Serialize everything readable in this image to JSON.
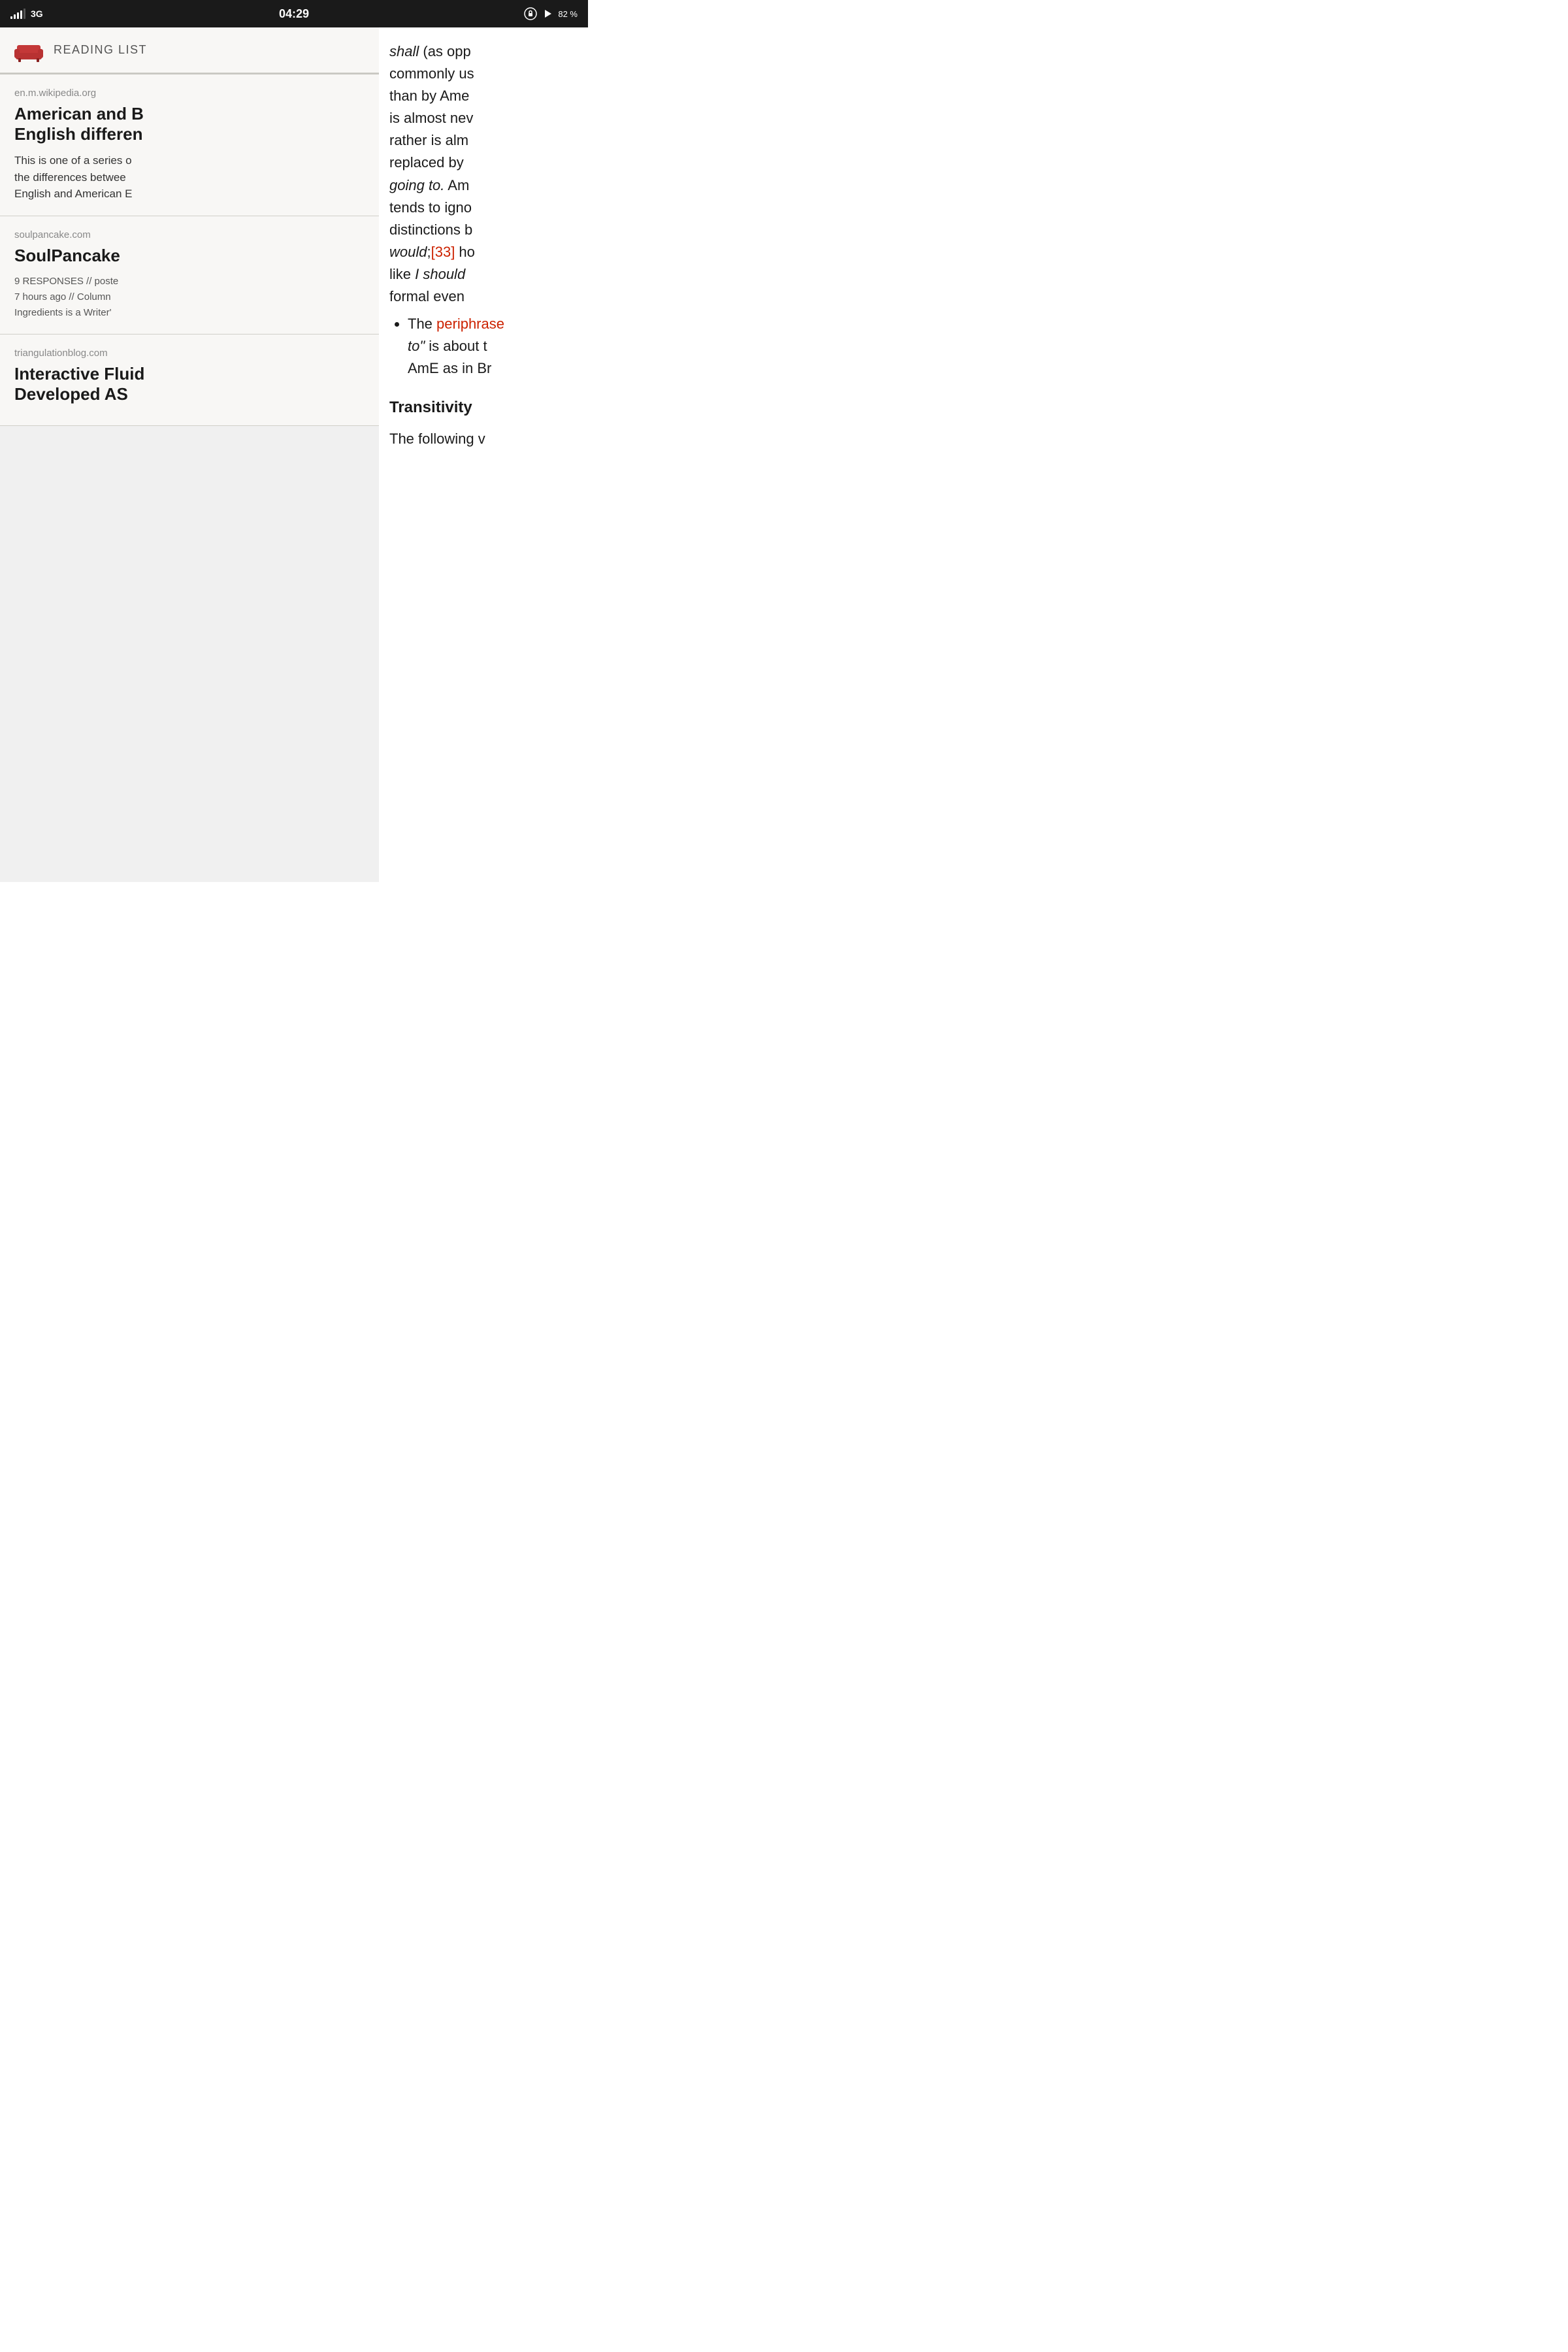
{
  "statusBar": {
    "signal": "3G",
    "time": "04:29",
    "battery": "82 %"
  },
  "readingList": {
    "title": "READING LIST",
    "items": [
      {
        "source": "en.m.wikipedia.org",
        "title": "American and B\nEnglish differen",
        "excerpt": "This is one of a series o the differences betwee English and American E"
      },
      {
        "source": "soulpancake.com",
        "title": "SoulPancake",
        "meta": "9 RESPONSES // poste 7 hours ago // Column Ingredients is a Writer'"
      },
      {
        "source": "triangulationblog.com",
        "title": "Interactive Fluid\nDeveloped AS"
      }
    ]
  },
  "article": {
    "paragraphLines": [
      "shall (as opp",
      "commonly us",
      "than by Ame",
      "is almost nev",
      "rather is alm",
      "replaced by",
      "going to. Am",
      "tends to igno",
      "distinctions b",
      "would;[33] ho",
      "like I should",
      "formal even"
    ],
    "bulletItems": [
      {
        "textBefore": "The ",
        "linkText": "periphrase",
        "textAfter": " to\" is about t AmE as in Br"
      }
    ],
    "sectionHeading": "Transitivity",
    "finalText": "The following v"
  }
}
